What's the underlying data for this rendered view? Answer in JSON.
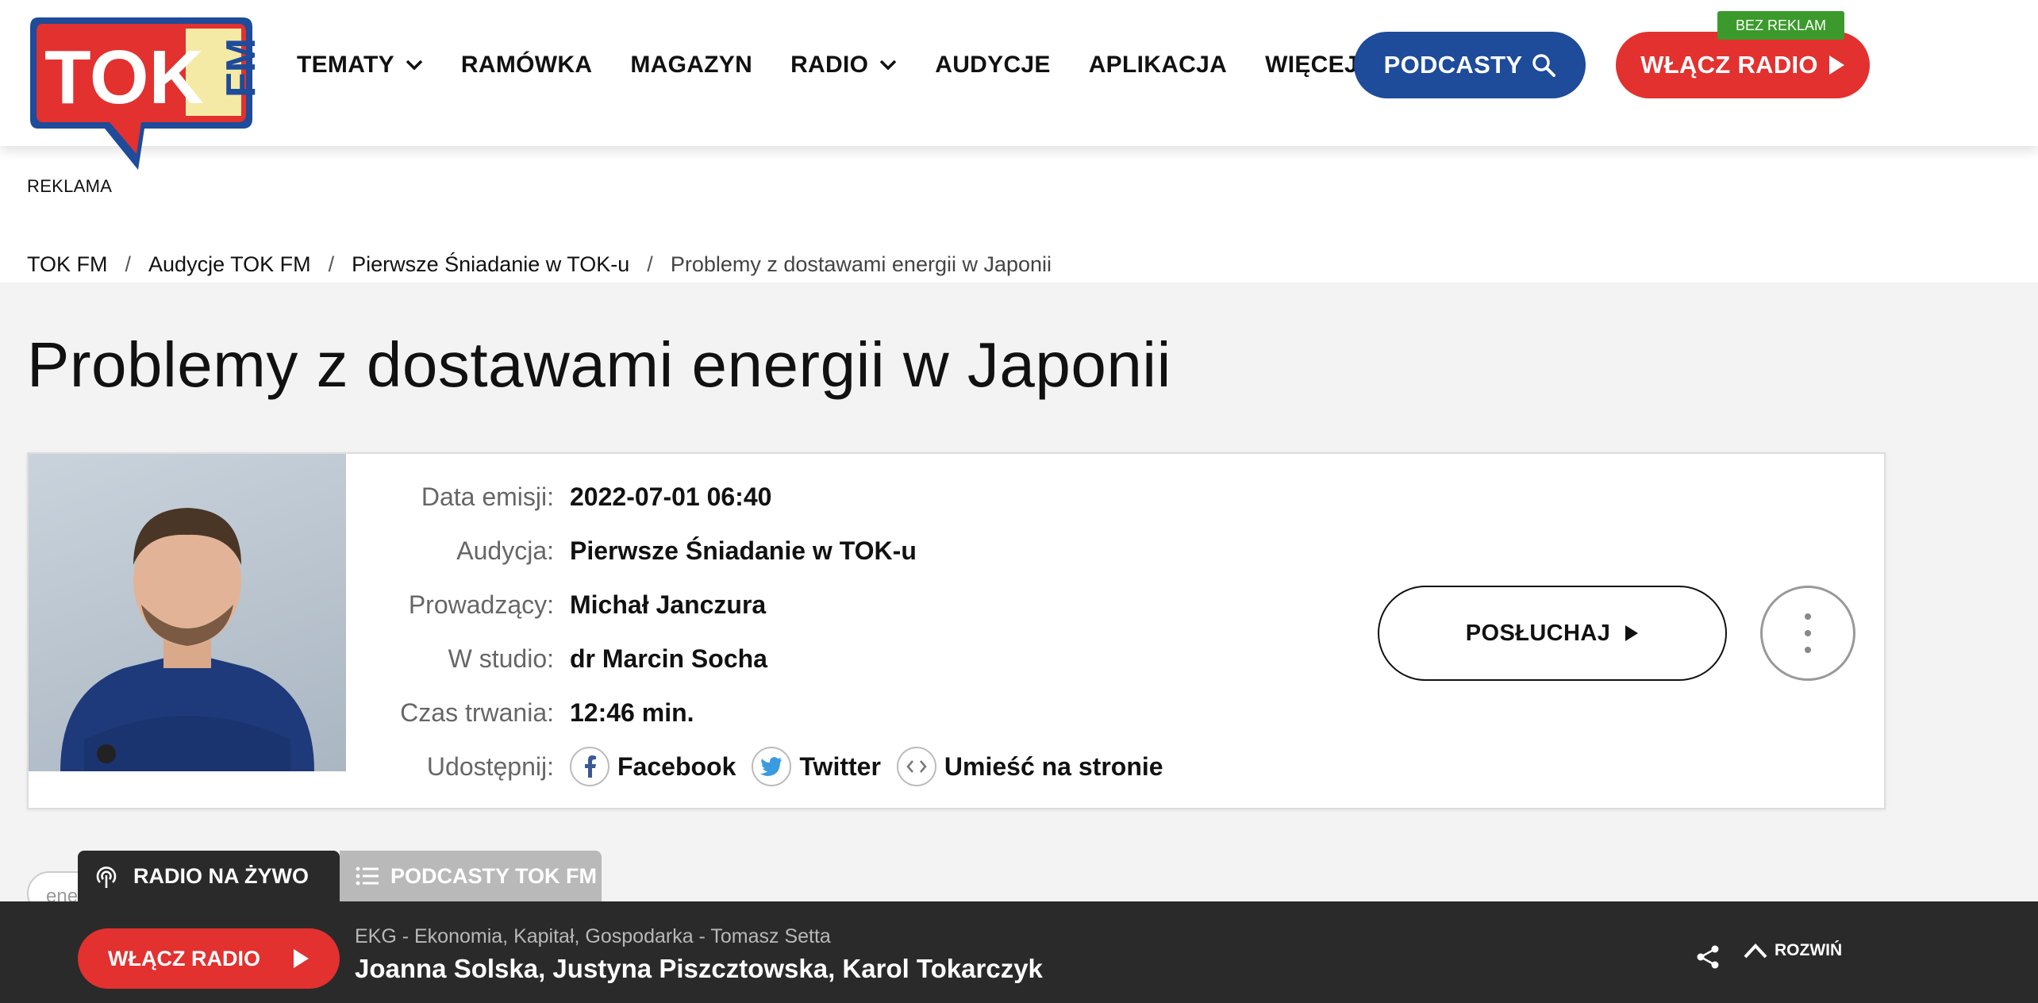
{
  "brand": {
    "logo_text_main": "TOK",
    "logo_text_side": "FM",
    "accent_red": "#e2312f",
    "accent_blue": "#1e4b9a",
    "badge_green": "#3b9a2b"
  },
  "nav": {
    "items": [
      {
        "label": "TEMATY",
        "dropdown": true
      },
      {
        "label": "RAMÓWKA",
        "dropdown": false
      },
      {
        "label": "MAGAZYN",
        "dropdown": false
      },
      {
        "label": "RADIO",
        "dropdown": true
      },
      {
        "label": "AUDYCJE",
        "dropdown": false
      },
      {
        "label": "APLIKACJA",
        "dropdown": false
      },
      {
        "label": "WIĘCEJ",
        "dropdown": true
      }
    ],
    "podcasty_label": "PODCASTY",
    "wlacz_radio_label": "WŁĄCZ RADIO",
    "bez_reklam_badge": "BEZ REKLAM"
  },
  "ad": {
    "label": "REKLAMA"
  },
  "breadcrumb": {
    "items": [
      "TOK FM",
      "Audycje TOK FM",
      "Pierwsze Śniadanie w TOK-u"
    ],
    "current": "Problemy z dostawami energii w Japonii",
    "separator": "/"
  },
  "page": {
    "title": "Problemy z dostawami energii w Japonii"
  },
  "episode": {
    "rows": [
      {
        "label": "Data emisji:",
        "value": "2022-07-01 06:40"
      },
      {
        "label": "Audycja:",
        "value": "Pierwsze Śniadanie w TOK-u"
      },
      {
        "label": "Prowadzący:",
        "value": "Michał Janczura"
      },
      {
        "label": "W studio:",
        "value": "dr Marcin Socha"
      },
      {
        "label": "Czas trwania:",
        "value": "12:46 min."
      }
    ],
    "share_label": "Udostępnij:",
    "share": {
      "facebook": "Facebook",
      "twitter": "Twitter",
      "embed": "Umieść na stronie"
    },
    "listen_label": "POSŁUCHAJ"
  },
  "tag": {
    "partial_text": "ene"
  },
  "player": {
    "tab_live": "RADIO NA ŻYWO",
    "tab_podcasts": "PODCASTY TOK FM",
    "button_label": "WŁĄCZ RADIO",
    "program": "EKG - Ekonomia, Kapitał, Gospodarka - Tomasz Setta",
    "hosts": "Joanna Solska, Justyna Piszcztowska, Karol Tokarczyk",
    "expand_label": "ROZWIŃ"
  }
}
